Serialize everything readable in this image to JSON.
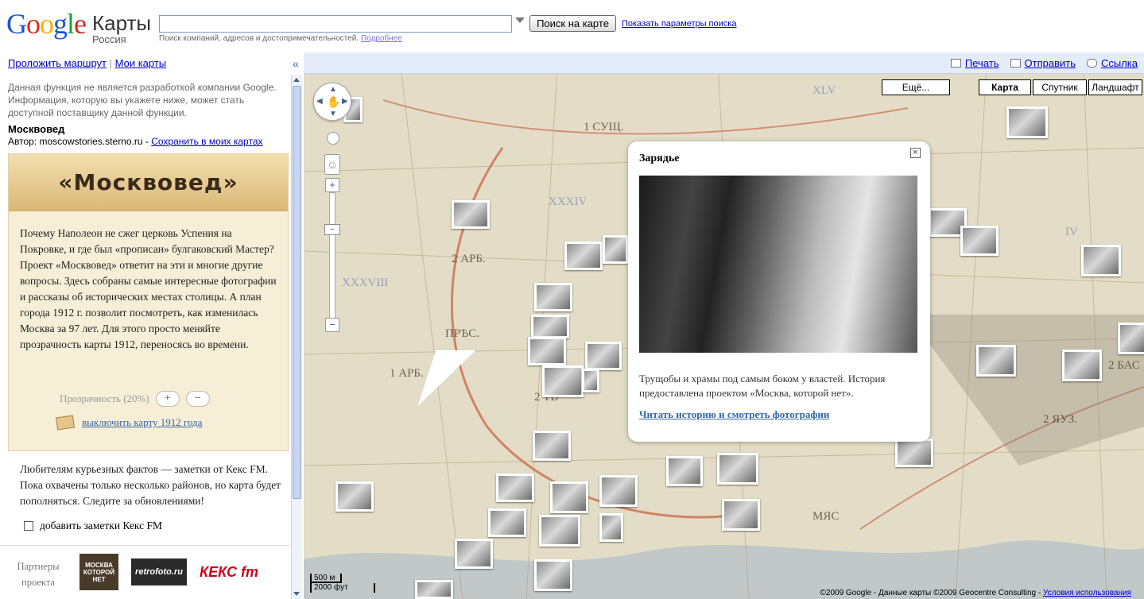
{
  "header": {
    "logo_text": "Google",
    "product": "Карты",
    "region": "Россия",
    "search_value": "",
    "search_button": "Поиск на карте",
    "search_options_link": "Показать параметры поиска",
    "search_hint": "Поиск компаний, адресов и достопримечательностей.",
    "search_hint_link": "Подробнее"
  },
  "sidebar": {
    "route_link": "Проложить маршрут",
    "my_maps_link": "Мои карты",
    "collapse_glyph": "«",
    "notice": "Данная функция не является разработкой компании Google. Информация, которую вы укажете ниже, может стать доступной поставщику данной функции.",
    "map_name": "Москвовед",
    "author_label": "Автор: moscowstories.sterno.ru",
    "author_sep": " - ",
    "save_link": "Сохранить в моих картах",
    "card": {
      "banner": "«Москвовед»",
      "text": "Почему Наполеон не сжег церковь Успения на Покровке, и где был «прописан» булгаковский Мастер? Проект «Москвовед» ответит на эти и многие другие вопросы. Здесь собраны самые интересные фотографии и рассказы об исторических местах столицы. А план города 1912 г. позволит посмотреть, как изменилась Москва за 97 лет. Для этого просто меняйте прозрачность карты 1912, переносясь во времени.",
      "transparency_label": "Прозрачность (20%)",
      "plus": "+",
      "minus": "−",
      "disable_1912_link": "выключить карту 1912 года"
    },
    "kex_text": "Любителям курьезных фактов — заметки от Кекс FM. Пока охвачены только несколько районов, но карта будет пополняться. Следите за обновлениями!",
    "kex_checkbox_label": "добавить заметки Кекс FM",
    "partners_label": "Партнеры проекта",
    "partner1": "МОСКВА КОТОРОЙ НЕТ",
    "partner2": "retrofoto.ru",
    "partner3": "КЕКС fm"
  },
  "map": {
    "print_link": "Печать",
    "send_link": "Отправить",
    "link_link": "Ссылка",
    "types": {
      "more": "Ещё...",
      "map": "Карта",
      "satellite": "Спутник",
      "terrain": "Ландшафт"
    },
    "scale_m": "500 м",
    "scale_ft": "2000 фут",
    "copyright": "©2009 Google - Данные карты ©2009 Geocentre Consulting - ",
    "terms_link": "Условия использования",
    "labels": [
      "1 СУЩ.",
      "XXXIV",
      "2 АРБ.",
      "XXXVIII",
      "ПРѢС.",
      "1 АРБ.",
      "2 ТВ",
      "IV",
      "2 ЯУЗ.",
      "2 БАС",
      "МЯС",
      "XLV"
    ]
  },
  "popup": {
    "title": "Зарядье",
    "close": "×",
    "text": "Трущобы и храмы под самым боком у властей. История предоставлена проектом «Москва, которой нет».",
    "link": "Читать историю и смотреть фотографии"
  },
  "colors": {
    "link": "#0000cc",
    "map_bar": "#e5ecf9",
    "card_bg": "#f6eed6",
    "map_paper": "#e9dfc2"
  }
}
